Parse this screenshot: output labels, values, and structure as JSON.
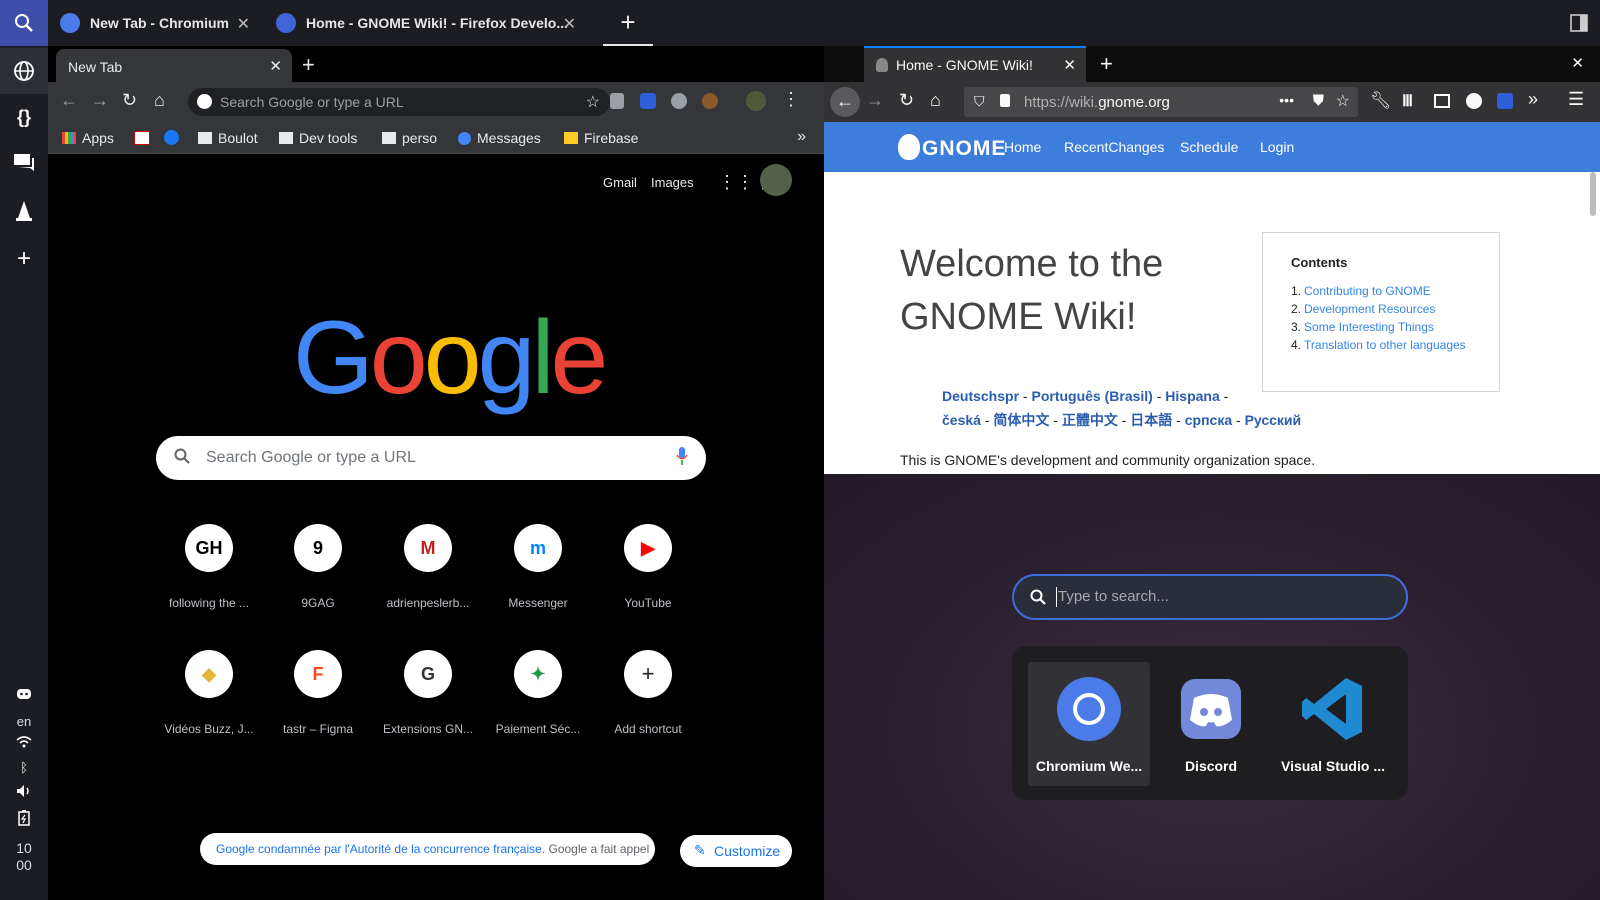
{
  "rail": {
    "lang": "en",
    "clock_h": "10",
    "clock_m": "00"
  },
  "workspace_tabs": [
    {
      "title": "New Tab - Chromium"
    },
    {
      "title": "Home - GNOME Wiki! - Firefox Develo..."
    }
  ],
  "chromium": {
    "tab_title": "New Tab",
    "omnibox_placeholder": "Search Google or type a URL",
    "bookmarks": [
      "Apps",
      "Boulot",
      "Dev tools",
      "perso",
      "Messages",
      "Firebase"
    ],
    "top_links": {
      "gmail": "Gmail",
      "images": "Images"
    },
    "logo": "Google",
    "search_placeholder": "Search Google or type a URL",
    "shortcuts_row1": [
      {
        "label": "following the ...",
        "glyph": "GH"
      },
      {
        "label": "9GAG",
        "glyph": "9"
      },
      {
        "label": "adrienpeslerb...",
        "glyph": "M"
      },
      {
        "label": "Messenger",
        "glyph": "m"
      },
      {
        "label": "YouTube",
        "glyph": "▶"
      }
    ],
    "shortcuts_row2": [
      {
        "label": "Vidéos Buzz, J...",
        "glyph": "◆"
      },
      {
        "label": "tastr – Figma",
        "glyph": "F"
      },
      {
        "label": "Extensions GN...",
        "glyph": "G"
      },
      {
        "label": "Paiement Séc...",
        "glyph": "✦"
      },
      {
        "label": "Add shortcut",
        "glyph": "+"
      }
    ],
    "news_link": "Google condamnée par l'Autorité de la concurrence française.",
    "news_text": " Google a fait appel",
    "customize": "Customize"
  },
  "firefox": {
    "tab_title": "Home - GNOME Wiki!",
    "url_prefix": "https://wiki.",
    "url_host": "gnome.org",
    "nav": [
      "Home",
      "RecentChanges",
      "Schedule",
      "Login"
    ],
    "logo": "GNOME",
    "welcome": "Welcome to the GNOME Wiki!",
    "contents_title": "Contents",
    "contents": [
      "Contributing to GNOME",
      "Development Resources",
      "Some Interesting Things",
      "Translation to other languages"
    ],
    "languages": [
      "Deutschspr",
      "Português (Brasil)",
      "Hispana",
      "česká",
      "简体中文",
      "正體中文",
      "日本語",
      "српска",
      "Русский"
    ],
    "intro": "This is GNOME's development and community organization space."
  },
  "launcher": {
    "search_placeholder": "Type to search...",
    "apps": [
      {
        "label": "Chromium We..."
      },
      {
        "label": "Discord"
      },
      {
        "label": "Visual Studio ..."
      }
    ]
  },
  "colors": {
    "accent": "#3f4ea8",
    "gnome_blue": "#3d7ddb",
    "link": "#1a73e8"
  }
}
